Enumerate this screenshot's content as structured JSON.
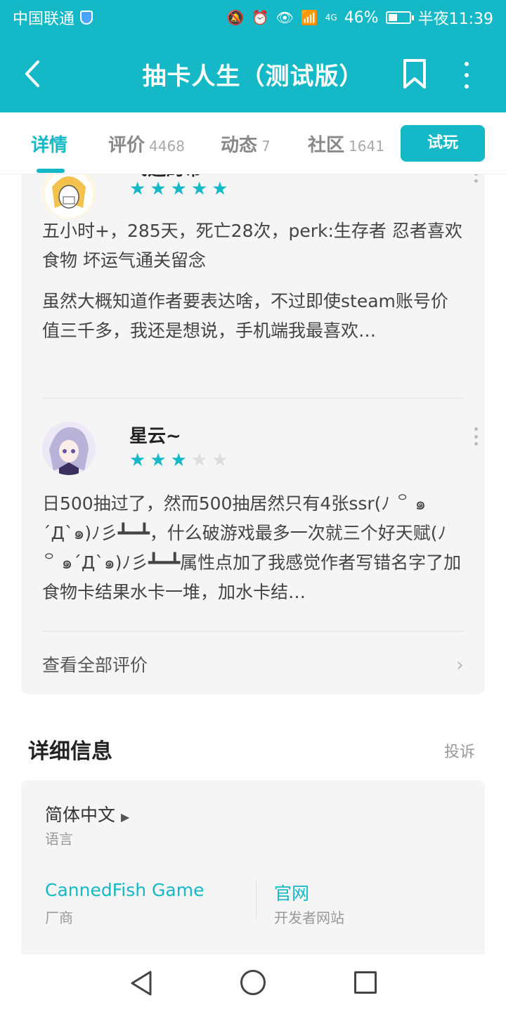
{
  "status_bar": {
    "carrier": "中国联通",
    "battery": "46%",
    "network": "4G",
    "time": "半夜11:39"
  },
  "header": {
    "title": "抽卡人生（测试版）"
  },
  "tabs": [
    {
      "label": "详情",
      "count": ""
    },
    {
      "label": "评价",
      "count": "4468"
    },
    {
      "label": "动态",
      "count": "7"
    },
    {
      "label": "社区",
      "count": "1641"
    }
  ],
  "try_button": "试玩",
  "reviews": [
    {
      "username": "飞逝的帝",
      "rating": 5,
      "line1": "五小时+，285天，死亡28次，perk:生存者 忍者喜欢食物 坏运气通关留念",
      "line2": "虽然大概知道作者要表达啥，不过即使steam账号价值三千多，我还是想说，手机端我最喜欢…"
    },
    {
      "username": "星云~",
      "rating": 3,
      "line1": "日500抽过了，然而500抽居然只有4张ssr(ﾉ ꒪ ๑´Д`๑)ﾉ彡┻━┻，什么破游戏最多一次就三个好天赋(ﾉ ꒪ ๑´Д`๑)ﾉ彡┻━┻属性点加了我感觉作者写错名字了加食物卡结果水卡一堆，加水卡结…"
    }
  ],
  "see_all": "查看全部评价",
  "details": {
    "title": "详细信息",
    "report": "投诉",
    "language": "简体中文",
    "language_label": "语言",
    "vendor": "CannedFish Game",
    "vendor_label": "厂商",
    "site": "官网",
    "site_label": "开发者网站"
  },
  "colors": {
    "accent": "#14b8c7",
    "card_bg": "#f5f5f5"
  }
}
